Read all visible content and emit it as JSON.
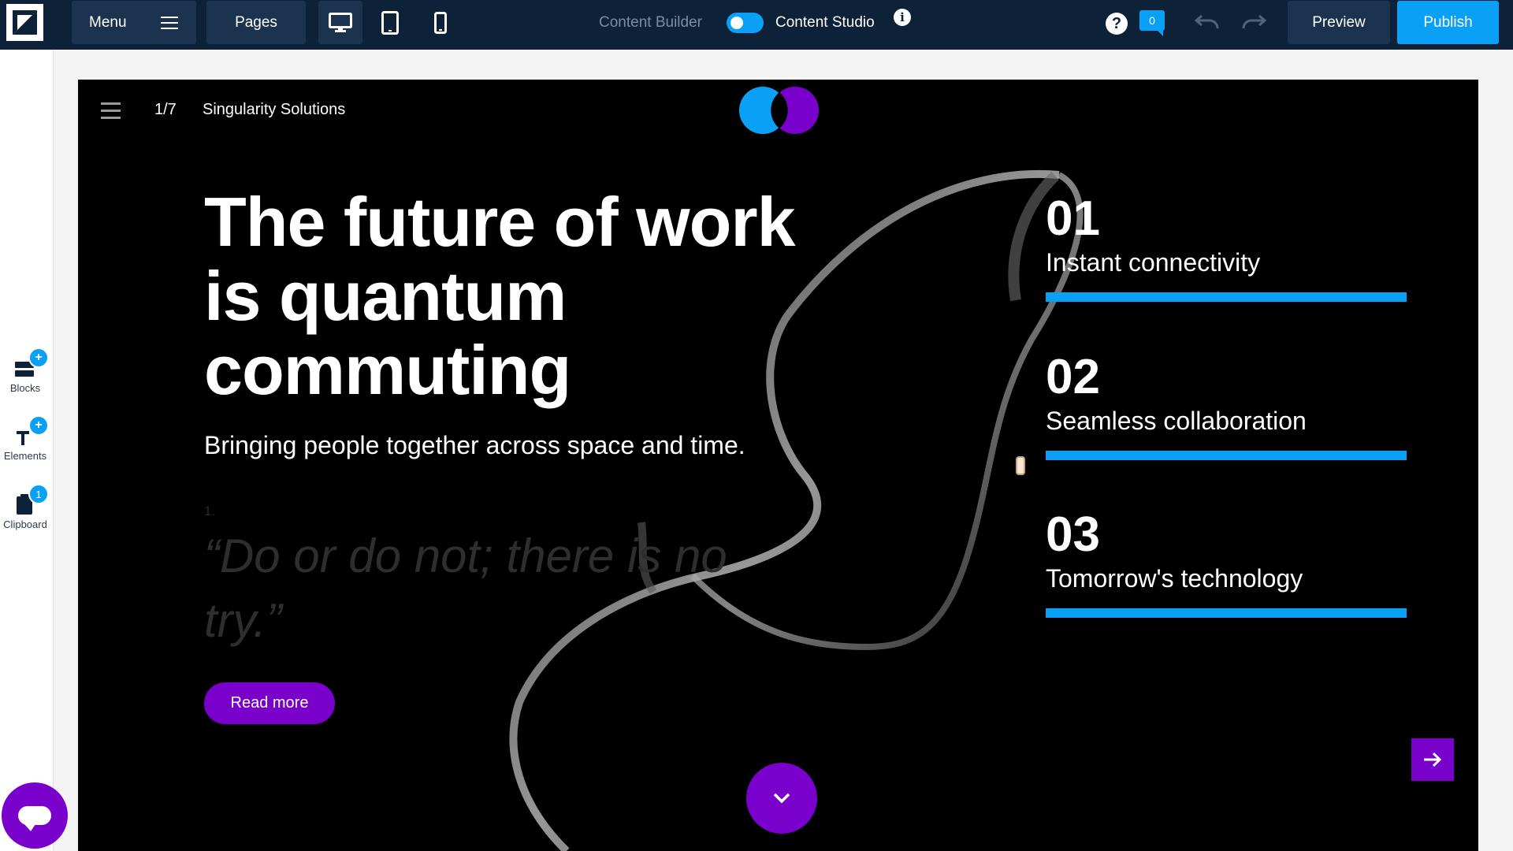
{
  "toolbar": {
    "menu_label": "Menu",
    "pages_label": "Pages",
    "devices": [
      "desktop-icon",
      "tablet-icon",
      "mobile-icon"
    ],
    "active_device": "desktop",
    "mode_left": "Content Builder",
    "mode_right": "Content Studio",
    "mode_toggle_on": true,
    "info_glyph": "i",
    "help_glyph": "?",
    "notification_count": "0",
    "preview_label": "Preview",
    "publish_label": "Publish"
  },
  "sidebar": {
    "items": [
      {
        "label": "Blocks",
        "badge": "+",
        "icon": "blocks-icon"
      },
      {
        "label": "Elements",
        "badge": "+",
        "icon": "text-tool-icon"
      },
      {
        "label": "Clipboard",
        "badge": "1",
        "icon": "clipboard-icon"
      }
    ]
  },
  "page": {
    "slide_counter": "1/7",
    "site_name": "Singularity Solutions",
    "headline": "The future of work is quantum commuting",
    "subheadline": "Bringing people together across space and time.",
    "list_marker": "1.",
    "quote": "“Do or do not; there is no try.”",
    "cta_label": "Read more",
    "features": [
      {
        "number": "01",
        "title": "Instant connectivity"
      },
      {
        "number": "02",
        "title": "Seamless collaboration"
      },
      {
        "number": "03",
        "title": "Tomorrow's technology"
      }
    ]
  },
  "colors": {
    "topbar": "#0d2138",
    "accent_blue": "#0aa0f5",
    "accent_purple": "#7a00cc",
    "page_bg": "#000000"
  }
}
